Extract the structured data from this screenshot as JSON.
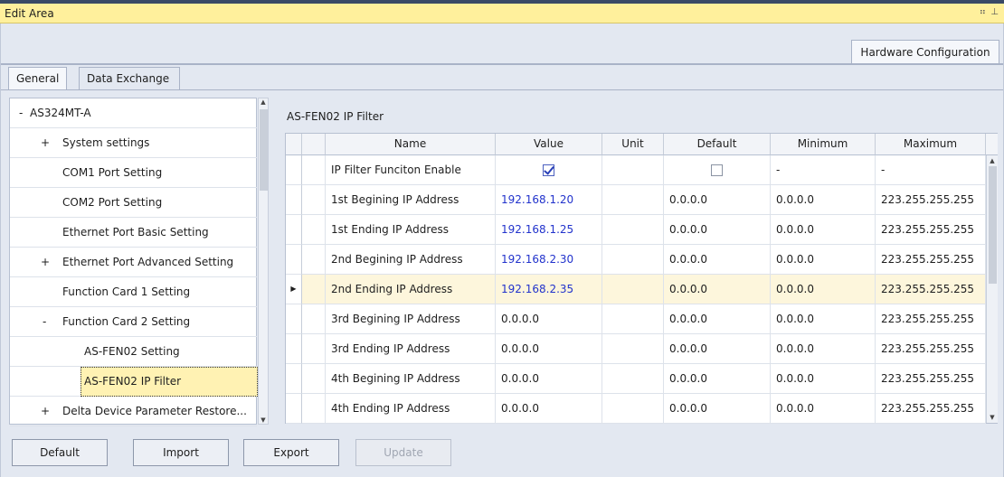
{
  "window": {
    "title": "Edit Area",
    "controls": [
      "⠶",
      "⊥"
    ]
  },
  "tabs": {
    "hardware": "Hardware Configuration",
    "general": "General",
    "data_exchange": "Data Exchange"
  },
  "tree": {
    "items": [
      {
        "prefix": "-",
        "label": "AS324MT-A"
      },
      {
        "prefix": "+",
        "label": "System settings"
      },
      {
        "prefix": "",
        "label": "COM1 Port Setting"
      },
      {
        "prefix": "",
        "label": "COM2 Port Setting"
      },
      {
        "prefix": "",
        "label": "Ethernet Port Basic Setting"
      },
      {
        "prefix": "+",
        "label": "Ethernet Port Advanced Setting"
      },
      {
        "prefix": "",
        "label": "Function Card 1 Setting"
      },
      {
        "prefix": "-",
        "label": "Function Card 2 Setting"
      },
      {
        "prefix": "",
        "label": "AS-FEN02 Setting"
      },
      {
        "prefix": "",
        "label": "AS-FEN02 IP Filter"
      },
      {
        "prefix": "+",
        "label": "Delta Device Parameter Restore..."
      }
    ]
  },
  "grid": {
    "title": "AS-FEN02 IP Filter",
    "headers": [
      "Name",
      "Value",
      "Unit",
      "Default",
      "Minimum",
      "Maximum"
    ],
    "rows": [
      {
        "name": "IP Filter Funciton Enable",
        "value": "",
        "unit": "",
        "default": "",
        "min": "-",
        "max": "-"
      },
      {
        "name": "1st Begining IP Address",
        "value": "192.168.1.20",
        "unit": "",
        "default": "0.0.0.0",
        "min": "0.0.0.0",
        "max": "223.255.255.255"
      },
      {
        "name": "1st Ending IP Address",
        "value": "192.168.1.25",
        "unit": "",
        "default": "0.0.0.0",
        "min": "0.0.0.0",
        "max": "223.255.255.255"
      },
      {
        "name": "2nd Begining IP Address",
        "value": "192.168.2.30",
        "unit": "",
        "default": "0.0.0.0",
        "min": "0.0.0.0",
        "max": "223.255.255.255"
      },
      {
        "name": "2nd Ending IP Address",
        "value": "192.168.2.35",
        "unit": "",
        "default": "0.0.0.0",
        "min": "0.0.0.0",
        "max": "223.255.255.255"
      },
      {
        "name": "3rd Begining IP Address",
        "value": "0.0.0.0",
        "unit": "",
        "default": "0.0.0.0",
        "min": "0.0.0.0",
        "max": "223.255.255.255"
      },
      {
        "name": "3rd Ending IP Address",
        "value": "0.0.0.0",
        "unit": "",
        "default": "0.0.0.0",
        "min": "0.0.0.0",
        "max": "223.255.255.255"
      },
      {
        "name": "4th Begining IP Address",
        "value": "0.0.0.0",
        "unit": "",
        "default": "0.0.0.0",
        "min": "0.0.0.0",
        "max": "223.255.255.255"
      },
      {
        "name": "4th Ending IP Address",
        "value": "0.0.0.0",
        "unit": "",
        "default": "0.0.0.0",
        "min": "0.0.0.0",
        "max": "223.255.255.255"
      }
    ],
    "enable_checked": true,
    "default_checked": false,
    "current_row_marker": "▶"
  },
  "buttons": {
    "default": "Default",
    "import": "Import",
    "export": "Export",
    "update": "Update"
  }
}
